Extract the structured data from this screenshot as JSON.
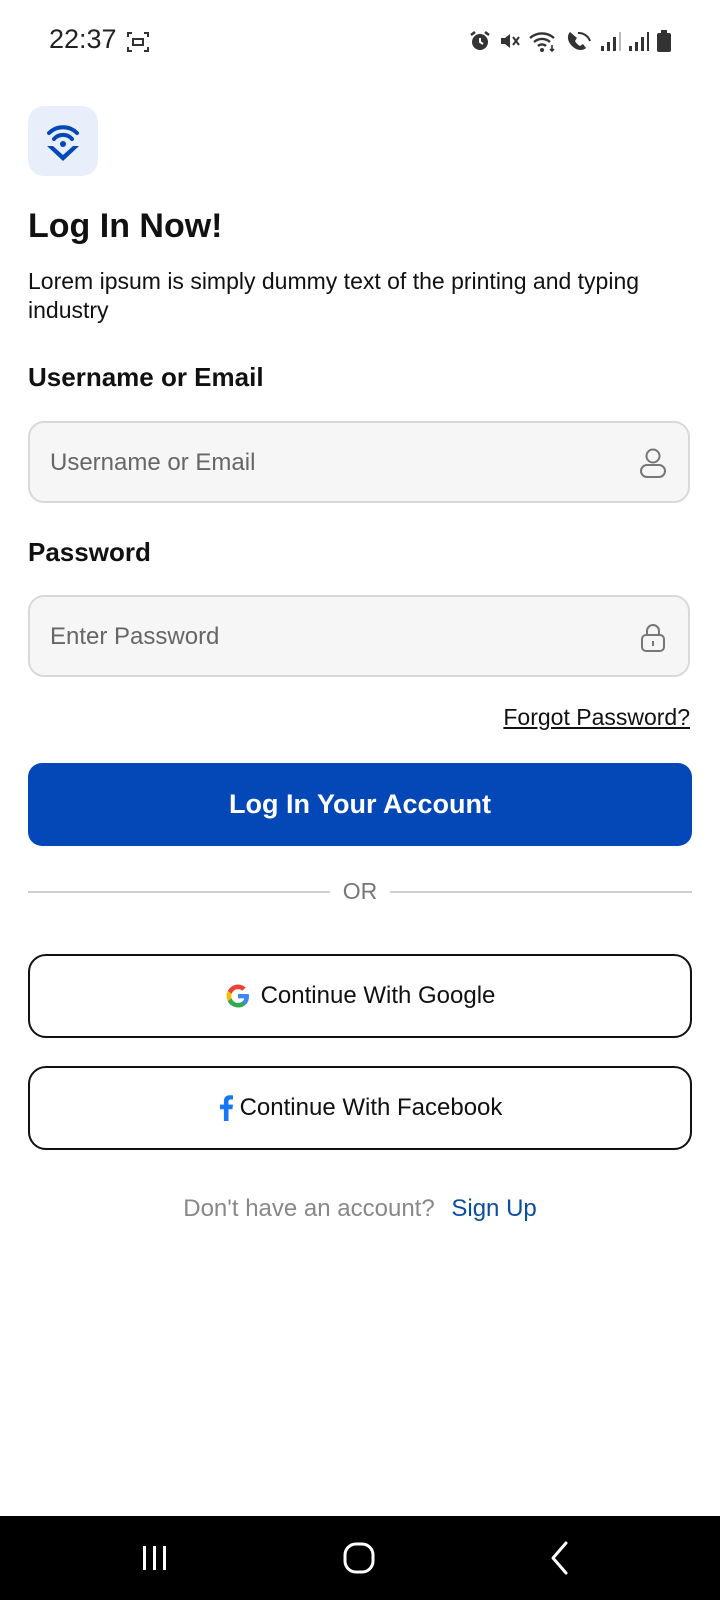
{
  "status_bar": {
    "time": "22:37",
    "icons": [
      "screenshot-icon",
      "alarm-icon",
      "mute-icon",
      "wifi-icon",
      "wifi-calling-icon",
      "signal-icon",
      "signal-icon",
      "battery-icon"
    ]
  },
  "header": {
    "logo_icon": "wifi-location-pin-icon",
    "title": "Log In Now!",
    "subtitle": "Lorem ipsum is simply dummy text of the printing and typing industry"
  },
  "form": {
    "username_label": "Username or Email",
    "username_placeholder": "Username or Email",
    "username_icon": "user-icon",
    "password_label": "Password",
    "password_placeholder": "Enter Password",
    "password_icon": "lock-icon",
    "forgot_password": "Forgot Password?",
    "login_button": "Log In Your Account"
  },
  "divider": {
    "text": "OR"
  },
  "social": {
    "google_label": "Continue With Google",
    "facebook_label": "Continue With Facebook"
  },
  "signup": {
    "prompt": "Don't have an account?",
    "link": "Sign Up"
  },
  "colors": {
    "primary": "#0447b6",
    "logo_bg": "#e9eefb",
    "link_blue": "#0c4da2",
    "input_bg": "#f6f6f6"
  },
  "nav_bar": {
    "buttons": [
      "recents-icon",
      "home-icon",
      "back-icon"
    ]
  }
}
